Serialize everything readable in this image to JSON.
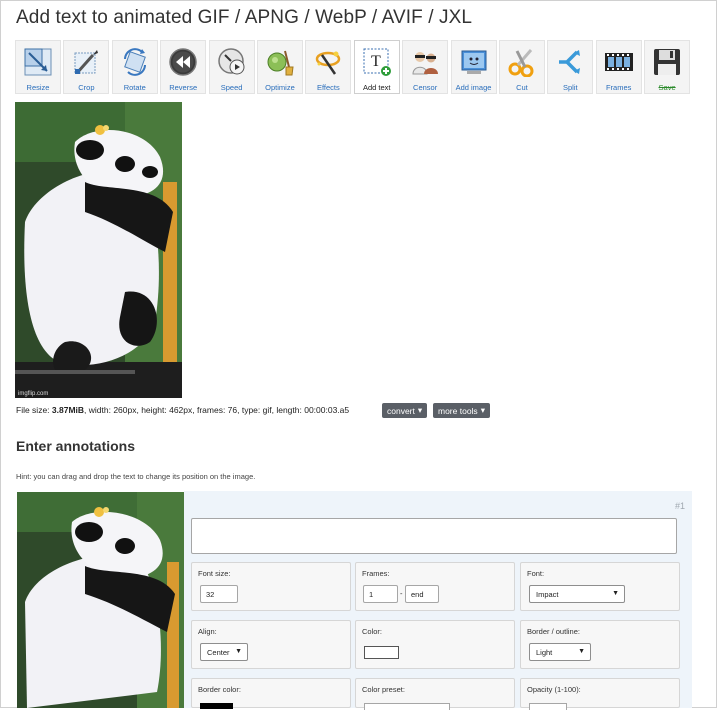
{
  "page": {
    "title": "Add text to animated GIF / APNG / WebP / AVIF / JXL"
  },
  "toolbar": {
    "items": [
      {
        "label": "Resize",
        "icon": "resize-icon"
      },
      {
        "label": "Crop",
        "icon": "crop-icon"
      },
      {
        "label": "Rotate",
        "icon": "rotate-icon"
      },
      {
        "label": "Reverse",
        "icon": "reverse-icon"
      },
      {
        "label": "Speed",
        "icon": "speed-icon"
      },
      {
        "label": "Optimize",
        "icon": "optimize-icon"
      },
      {
        "label": "Effects",
        "icon": "effects-icon"
      },
      {
        "label": "Add text",
        "icon": "add-text-icon",
        "active": true
      },
      {
        "label": "Censor",
        "icon": "censor-icon"
      },
      {
        "label": "Add image",
        "icon": "add-image-icon"
      },
      {
        "label": "Cut",
        "icon": "cut-icon"
      },
      {
        "label": "Split",
        "icon": "split-icon"
      },
      {
        "label": "Frames",
        "icon": "frames-icon"
      },
      {
        "label": "Save",
        "icon": "save-icon"
      }
    ]
  },
  "preview": {
    "watermark": "imgflip.com"
  },
  "fileinfo": {
    "prefix": "File size: ",
    "size": "3.87MiB",
    "rest": ", width: 260px, height: 462px, frames: 76, type: gif, length: 00:00:03.a5"
  },
  "buttons": {
    "convert": "convert",
    "more_tools": "more tools"
  },
  "annotations": {
    "heading": "Enter annotations",
    "hint": "Hint: you can drag and drop the text to change its position on the image.",
    "number": "#1",
    "font_size": {
      "label": "Font size:",
      "value": "32"
    },
    "frames": {
      "label": "Frames:",
      "from": "1",
      "sep": "-",
      "to": "end"
    },
    "font": {
      "label": "Font:",
      "value": "Impact"
    },
    "align": {
      "label": "Align:",
      "value": "Center"
    },
    "color": {
      "label": "Color:",
      "value": "#ffffff"
    },
    "border": {
      "label": "Border / outline:",
      "value": "Light"
    },
    "border_color": {
      "label": "Border color:"
    },
    "color_preset": {
      "label": "Color preset:"
    },
    "opacity": {
      "label": "Opacity (1-100):"
    }
  },
  "colors": {
    "link": "#2a6ebb",
    "panel": "#eef4fa",
    "dark_button": "#5a5f66"
  }
}
